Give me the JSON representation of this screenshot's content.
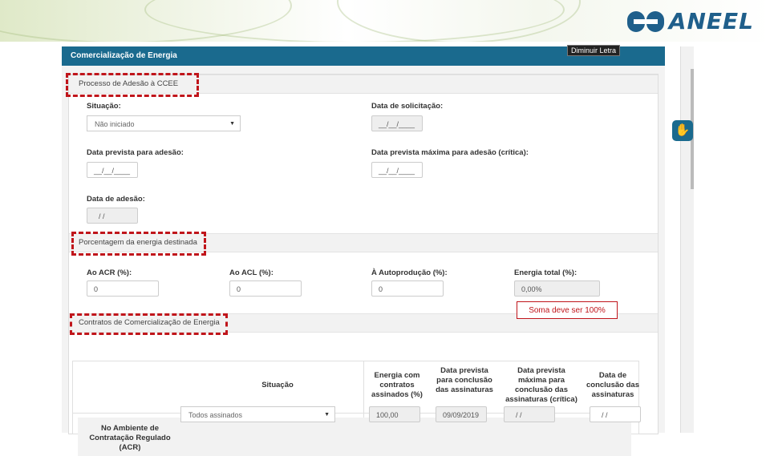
{
  "brand": {
    "logo_text": "ANEEL",
    "logo_color": "#1f5f8b"
  },
  "panel": {
    "title": "Comercialização de Energia",
    "font_button": "Diminuir Letra",
    "header_color": "#1a6a8e"
  },
  "sections": {
    "adesao": "Processo de Adesão à CCEE",
    "percentagem": "Porcentagem da energia destinada",
    "contratos": "Contratos de Comercialização de Energia"
  },
  "adesao_fields": {
    "situacao_label": "Situação:",
    "situacao_value": "Não iniciado",
    "data_solicitacao_label": "Data de solicitação:",
    "data_solicitacao_value": "__/__/____",
    "data_prevista_label": "Data prevista para adesão:",
    "data_prevista_value": "__/__/____",
    "data_prevista_max_label": "Data prevista máxima para adesão (crítica):",
    "data_prevista_max_value": "__/__/____",
    "data_adesao_label": "Data de adesão:",
    "data_adesao_value": "/ /"
  },
  "percent_fields": {
    "acr_label": "Ao ACR (%):",
    "acr_value": "0",
    "acl_label": "Ao ACL (%):",
    "acl_value": "0",
    "autoproducao_label": "À Autoprodução (%):",
    "autoproducao_value": "0",
    "total_label": "Energia total (%):",
    "total_value": "0,00%"
  },
  "warning": "Soma deve ser 100%",
  "contracts_table": {
    "headers": {
      "situacao": "Situação",
      "energia": "Energia com contratos assinados (%)",
      "data_prevista": "Data prevista para conclusão das assinaturas",
      "data_prevista_max": "Data prevista máxima para conclusão das assinaturas (crítica)",
      "data_conclusao": "Data de conclusão das assinaturas"
    },
    "row": {
      "label": "No Ambiente de Contratação Regulado (ACR)",
      "situacao": "Todos assinados",
      "energia": "100,00",
      "data_prevista": "09/09/2019",
      "data_prevista_max": "/ /",
      "data_conclusao": "/ /"
    }
  },
  "accessibility_icon": "sign-language-icon",
  "highlight_color": "#c0151b"
}
